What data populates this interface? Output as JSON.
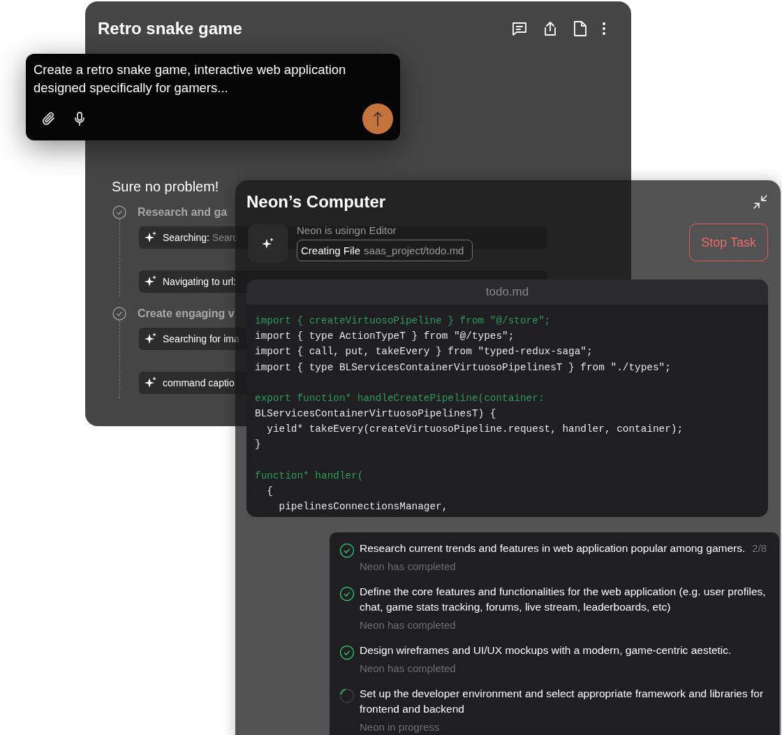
{
  "chat_window": {
    "title": "Retro snake game",
    "reply": "Sure no problem!",
    "steps": [
      {
        "title": "Research and ga",
        "done": true,
        "actions": [
          {
            "label": "Searching:",
            "detail": "Searc"
          },
          {
            "label": "Navigating to url:"
          }
        ]
      },
      {
        "title": "Create engaging v",
        "done": true,
        "actions": [
          {
            "label": "Searching for ima"
          },
          {
            "label": "command captio"
          }
        ]
      }
    ]
  },
  "prompt_box": {
    "value": "Create a retro snake game, interactive web application designed specifically for gamers..."
  },
  "computer_window": {
    "title": "Neon’s Computer",
    "activity": "Neon is usingn Editor",
    "action_label": "Creating File",
    "action_path": "saas_project/todo.md",
    "stop_button": "Stop Task",
    "editor": {
      "filename": "todo.md",
      "blocks": [
        {
          "lines": [
            {
              "text": "import { createVirtuosoPipeline } from \"@/store\";",
              "kind": "highlight"
            },
            {
              "text": "import { type ActionTypeT } from \"@/types\";",
              "kind": "plain"
            },
            {
              "text": "import { call, put, takeEvery } from \"typed-redux-saga\";",
              "kind": "plain"
            },
            {
              "text": "import { type BLServicesContainerVirtuosoPipelinesT } from \"./types\";",
              "kind": "plain"
            }
          ]
        },
        {
          "lines": [
            {
              "text": "export function* handleCreatePipeline(container:",
              "kind": "highlight"
            },
            {
              "text": "BLServicesContainerVirtuosoPipelinesT) {",
              "kind": "plain"
            },
            {
              "text": "  yield* takeEvery(createVirtuosoPipeline.request, handler, container);",
              "kind": "plain"
            },
            {
              "text": "}",
              "kind": "plain"
            }
          ]
        },
        {
          "lines": [
            {
              "text": "function* handler(",
              "kind": "highlight"
            },
            {
              "text": "  {",
              "kind": "plain"
            },
            {
              "text": "    pipelinesConnectionsManager,",
              "kind": "plain"
            }
          ]
        }
      ]
    },
    "tasks": [
      {
        "title": "Research current trends and features in web application popular among gamers.",
        "count": "2/8",
        "status": "Neon has completed",
        "done": true
      },
      {
        "title": "Define the core features and functionalities for the web application (e.g. user profiles, chat, game stats tracking, forums, live stream, leaderboards, etc)",
        "status": "Neon has completed",
        "done": true
      },
      {
        "title": "Design wireframes and UI/UX mockups with a modern, game-centric aestetic.",
        "status": "Neon has completed",
        "done": true
      },
      {
        "title": "Set up the developer environment and select appropriate framework and libraries for frontend and backend",
        "status": "Neon in progress",
        "done": false
      }
    ]
  }
}
